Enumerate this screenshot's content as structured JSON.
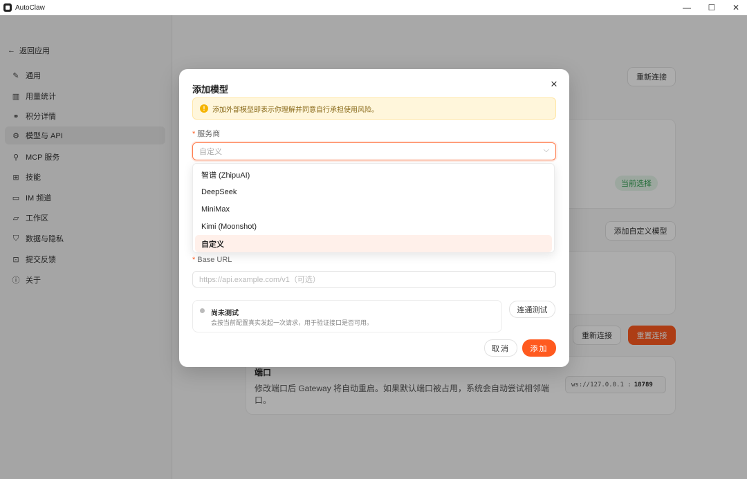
{
  "window": {
    "title": "AutoClaw",
    "controls": {
      "minimize": "—",
      "maximize": "☐",
      "close": "✕"
    }
  },
  "sidebar": {
    "back_label": "返回应用",
    "items": [
      {
        "label": "通用",
        "icon": "✎"
      },
      {
        "label": "用量统计",
        "icon": "▥"
      },
      {
        "label": "积分详情",
        "icon": "⚭"
      },
      {
        "label": "模型与 API",
        "icon": "⚙"
      },
      {
        "label": "MCP 服务",
        "icon": "⚲"
      },
      {
        "label": "技能",
        "icon": "⊞"
      },
      {
        "label": "IM 频道",
        "icon": "▭"
      },
      {
        "label": "工作区",
        "icon": "▱"
      },
      {
        "label": "数据与隐私",
        "icon": "⛉"
      },
      {
        "label": "提交反馈",
        "icon": "⊡"
      },
      {
        "label": "关于",
        "icon": "ⓘ"
      }
    ],
    "active_index": 3
  },
  "background": {
    "reconnect_top": "重新连接",
    "current_selected": "当前选择",
    "add_custom_model": "添加自定义模型",
    "reconnect": "重新连接",
    "reset_connect": "重置连接",
    "port_title": "端口",
    "port_desc": "修改端口后 Gateway 将自动重启。如果默认端口被占用，系统会自动尝试相邻端口。",
    "ws_prefix": "ws://127.0.0.1 :",
    "ws_port": "18789"
  },
  "modal": {
    "title": "添加模型",
    "close_icon": "×",
    "warning": "添加外部模型即表示你理解并同意自行承担使用风险。",
    "provider_label": "服务商",
    "provider_placeholder": "自定义",
    "provider_options": [
      "智谱 (ZhipuAI)",
      "DeepSeek",
      "MiniMax",
      "Kimi (Moonshot)",
      "自定义"
    ],
    "selected_option_index": 4,
    "base_url_label": "Base URL",
    "base_url_placeholder": "https://api.example.com/v1（可选）",
    "test_status_title": "尚未测试",
    "test_status_desc": "会按当前配置真实发起一次请求，用于验证接口是否可用。",
    "test_button": "连通测试",
    "cancel_button": "取消",
    "add_button": "添加",
    "accent_color": "#ff5a1f"
  }
}
